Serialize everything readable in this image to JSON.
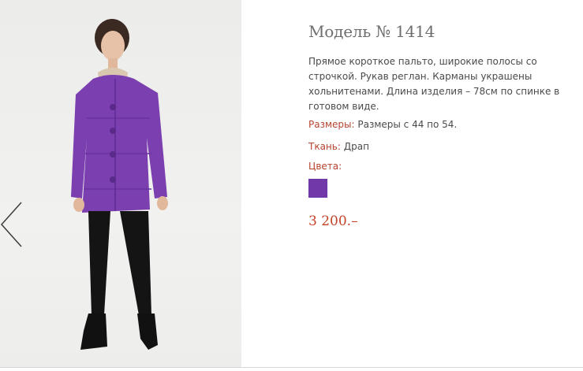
{
  "product": {
    "title": "Модель № 1414",
    "description": "Прямое короткое пальто, широкие полосы со  строчкой. Рукав реглан. Карманы украшены хольнитенами. Длина изделия –  78см по спинке в готовом виде.",
    "sizes_label": "Размеры:",
    "sizes_value": " Размеры с 44 по 54.",
    "fabric_label": "Ткань:",
    "fabric_value": " Драп",
    "colors_label": "Цвета:",
    "colors": [
      "#7038a8"
    ],
    "price": "3 200.–"
  },
  "gallery": {
    "prev_icon": "chevron-left-icon"
  },
  "theme": {
    "label_color": "#b5432e",
    "price_color": "#c44328",
    "coat_color": "#7b3fb0"
  }
}
